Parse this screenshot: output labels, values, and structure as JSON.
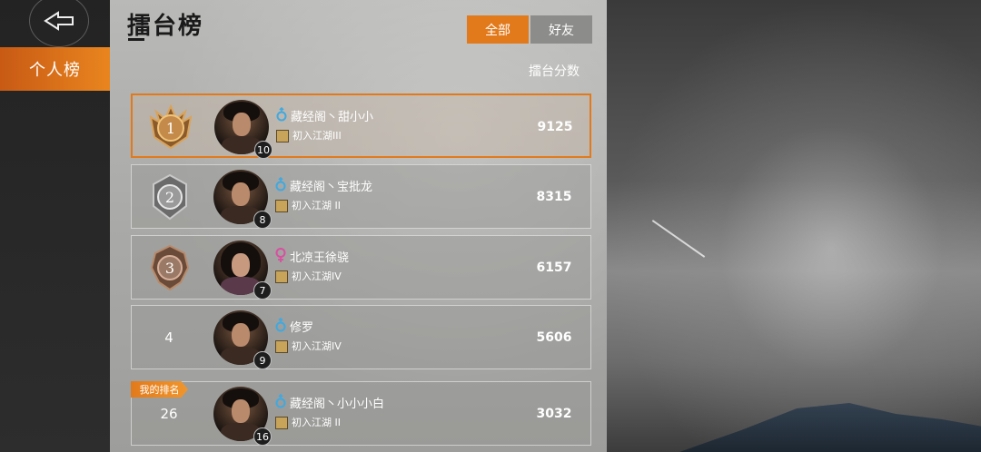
{
  "sidebar": {
    "tab_label": "个人榜"
  },
  "header": {
    "title": "擂台榜"
  },
  "filters": {
    "all": "全部",
    "friends": "好友"
  },
  "columns": {
    "score": "擂台分数"
  },
  "rows": [
    {
      "rank": "1",
      "name": "藏经阁丶甜小小",
      "gender": "male",
      "title": "初入江湖III",
      "level": "10",
      "score": "9125"
    },
    {
      "rank": "2",
      "name": "藏经阁丶宝批龙",
      "gender": "male",
      "title": "初入江湖 II",
      "level": "8",
      "score": "8315"
    },
    {
      "rank": "3",
      "name": "北凉王徐骁",
      "gender": "female",
      "title": "初入江湖IV",
      "level": "7",
      "score": "6157"
    },
    {
      "rank": "4",
      "name": "修罗",
      "gender": "male",
      "title": "初入江湖IV",
      "level": "9",
      "score": "5606"
    }
  ],
  "my_rank": {
    "tag": "我的排名",
    "rank": "26",
    "name": "藏经阁丶小小小白",
    "gender": "male",
    "title": "初入江湖 II",
    "level": "16",
    "score": "3032"
  },
  "colors": {
    "accent": "#e27a1c",
    "male": "#3fa9e0",
    "female": "#d84fa0"
  }
}
